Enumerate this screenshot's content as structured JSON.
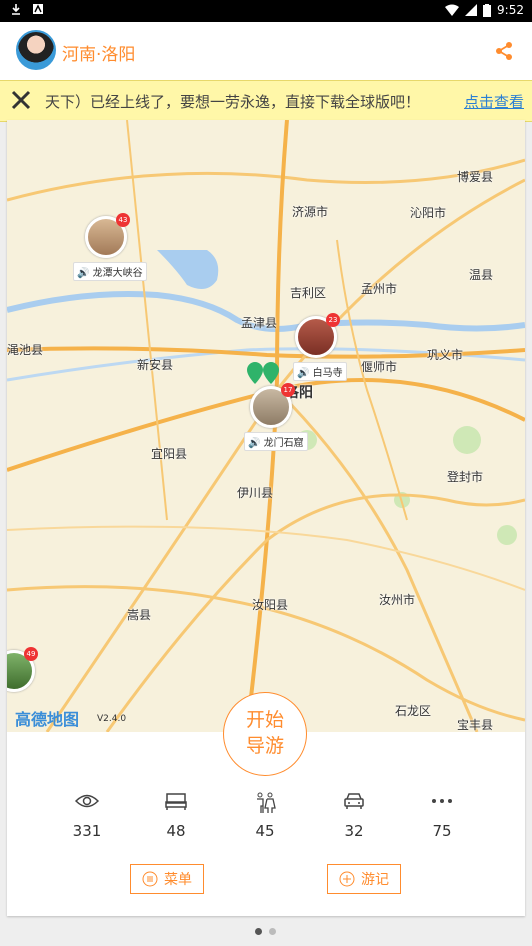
{
  "statusbar": {
    "time": "9:52"
  },
  "header": {
    "title": "河南·洛阳"
  },
  "banner": {
    "message": "天下）已经上线了，要想一劳永逸，直接下载全球版吧！",
    "link_label": "点击查看"
  },
  "map": {
    "places": [
      "博爱县",
      "济源市",
      "沁阳市",
      "温县",
      "吉利区",
      "孟州市",
      "孟津县",
      "渑池县",
      "新安县",
      "偃师市",
      "巩义市",
      "洛阳",
      "宜阳县",
      "伊川县",
      "登封市",
      "嵩县",
      "汝阳县",
      "汝州市",
      "石龙区",
      "宝丰县"
    ],
    "pois": [
      {
        "name": "龙潭大峡谷",
        "count": "43"
      },
      {
        "name": "白马寺",
        "count": "23"
      },
      {
        "name": "龙门石窟",
        "count": "17"
      },
      {
        "name": "",
        "count": "49"
      }
    ],
    "brand": "高德地图",
    "version": "V2.4.0"
  },
  "start_button": {
    "line1": "开始",
    "line2": "导游"
  },
  "stats": [
    {
      "icon": "eye-icon",
      "value": "331"
    },
    {
      "icon": "bed-icon",
      "value": "48"
    },
    {
      "icon": "restroom-icon",
      "value": "45"
    },
    {
      "icon": "car-icon",
      "value": "32"
    },
    {
      "icon": "more-icon",
      "value": "75"
    }
  ],
  "buttons": {
    "menu": "菜单",
    "travelogue": "游记"
  },
  "colors": {
    "accent": "#ff8c2e",
    "banner_bg": "#fff7a8",
    "link": "#2a7fd4"
  }
}
